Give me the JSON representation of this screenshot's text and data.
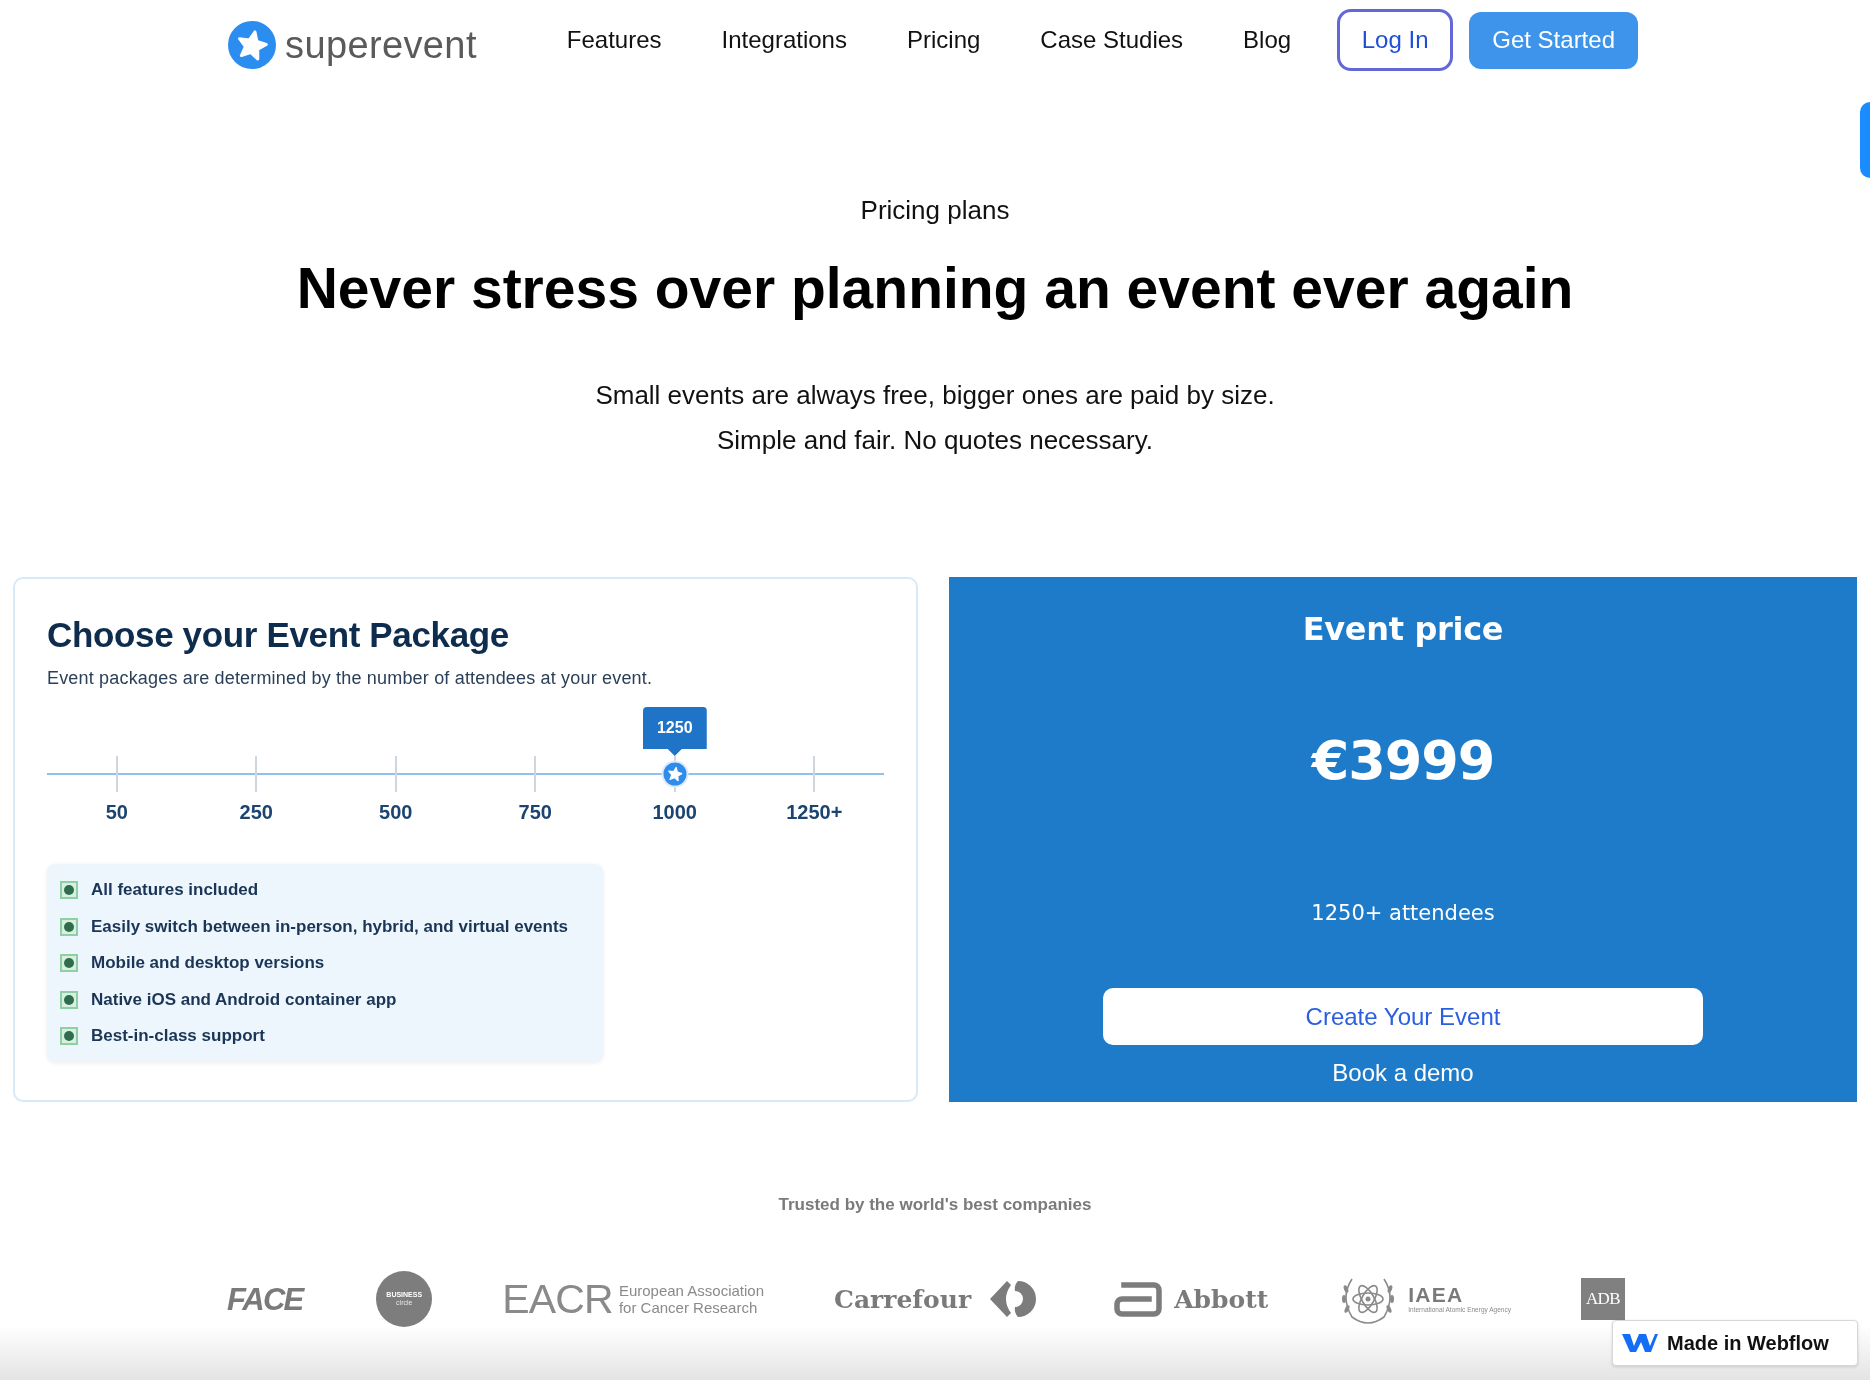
{
  "header": {
    "logo": "superevent",
    "nav": [
      "Features",
      "Integrations",
      "Pricing",
      "Case Studies",
      "Blog"
    ],
    "buttons": [
      {
        "label": "Log In",
        "kind": "outline"
      },
      {
        "label": "Get Started",
        "kind": "filled"
      }
    ]
  },
  "hero": {
    "eyebrow": "Pricing plans",
    "title": "Never stress over planning an event ever again",
    "subtitle_lines": [
      "Small events are always free, bigger ones are paid by size.",
      "Simple and fair. No quotes necessary."
    ]
  },
  "package_card": {
    "title": "Choose your Event Package",
    "description": "Event packages are determined by the number of attendees at your event.",
    "slider": {
      "tooltip": "1250",
      "level": 0.75,
      "ticks": [
        "50",
        "250",
        "500",
        "750",
        "1000",
        "1250+"
      ]
    },
    "features": [
      "All features included",
      "Easily switch between in-person, hybrid, and virtual events",
      "Mobile and desktop versions",
      "Native iOS and Android container app",
      "Best-in-class support"
    ]
  },
  "price_panel": {
    "title": "Event price",
    "price": "€3999",
    "attendees": "1250+ attendees",
    "primary_button": "Create Your Event",
    "secondary_link": "Book a demo"
  },
  "logos": {
    "heading": "Trusted by the world's best companies",
    "items": [
      {
        "kind": "italic",
        "wordmark": "FACE"
      },
      {
        "kind": "disc",
        "wordmark": "BUSINESS",
        "tagline_lines": [
          "circle"
        ]
      },
      {
        "kind": "split",
        "wordmark": "EACR",
        "tagline_lines": [
          "European Association",
          "for Cancer Research"
        ]
      },
      {
        "kind": "arrows",
        "wordmark": "Carrefour"
      },
      {
        "kind": "frame",
        "wordmark": "Abbott"
      },
      {
        "kind": "wreath",
        "wordmark": "IAEA",
        "tagline_lines": [
          "International Atomic Energy Agency"
        ]
      },
      {
        "kind": "tile",
        "wordmark": "ADB"
      }
    ]
  },
  "badge": {
    "label": "Made in Webflow"
  }
}
